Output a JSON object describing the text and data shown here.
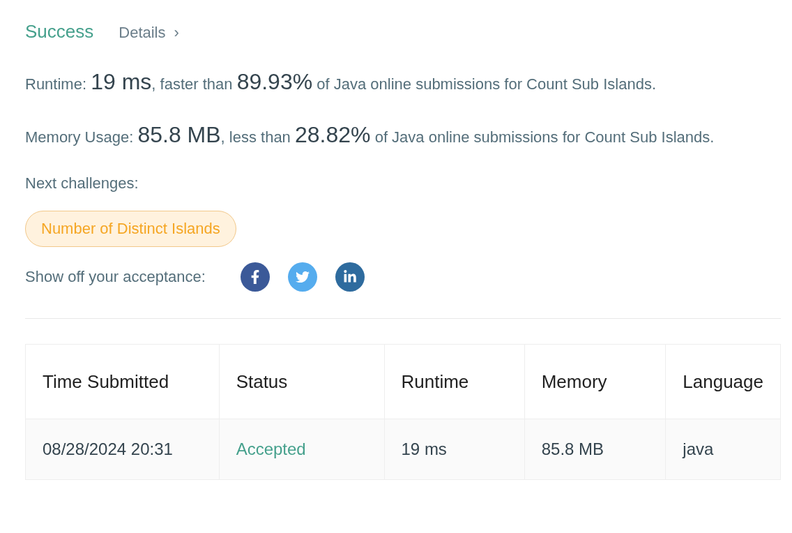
{
  "header": {
    "status": "Success",
    "details_link": "Details",
    "details_arrow": "›"
  },
  "stats": [
    {
      "label": "Runtime:",
      "value": "19 ms",
      "mid": ", faster than",
      "percent": "89.93%",
      "tail": "of Java online submissions for Count Sub Islands."
    },
    {
      "label": "Memory Usage:",
      "value": "85.8 MB",
      "mid": ", less than",
      "percent": "28.82%",
      "tail": "of Java online submissions for Count Sub Islands."
    }
  ],
  "next_challenges": {
    "label": "Next challenges:",
    "items": [
      "Number of Distinct Islands"
    ]
  },
  "share": {
    "label": "Show off your acceptance:",
    "networks": [
      {
        "kind": "facebook",
        "color": "#3b5998"
      },
      {
        "kind": "twitter",
        "color": "#55acee"
      },
      {
        "kind": "linkedin",
        "color": "#2e6b9e"
      }
    ]
  },
  "table": {
    "columns": [
      "Time Submitted",
      "Status",
      "Runtime",
      "Memory",
      "Language"
    ],
    "rows": [
      {
        "time": "08/28/2024 20:31",
        "status": "Accepted",
        "runtime": "19 ms",
        "memory": "85.8 MB",
        "language": "java"
      }
    ]
  }
}
